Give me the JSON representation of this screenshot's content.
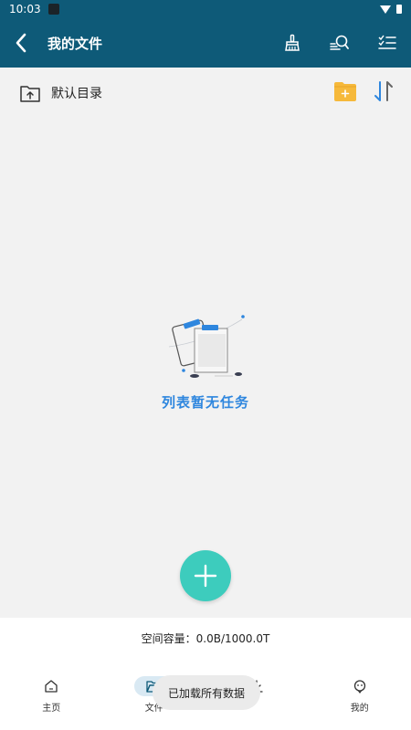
{
  "status_bar": {
    "time": "10:03"
  },
  "header": {
    "title": "我的文件"
  },
  "directory": {
    "label": "默认目录"
  },
  "empty_state": {
    "message": "列表暂无任务"
  },
  "storage": {
    "text": "空间容量：0.0B/1000.0T"
  },
  "bottom_nav": {
    "items": [
      {
        "label": "主页",
        "icon": "home-icon"
      },
      {
        "label": "文件",
        "icon": "folder-icon",
        "active": true
      },
      {
        "label": "",
        "icon": "download-icon"
      },
      {
        "label": "我的",
        "icon": "profile-icon"
      }
    ]
  },
  "toast": {
    "text": "已加载所有数据"
  },
  "colors": {
    "primary": "#0e5a78",
    "accent": "#3dccbd",
    "link": "#2e86de",
    "folder": "#f6b93b"
  }
}
